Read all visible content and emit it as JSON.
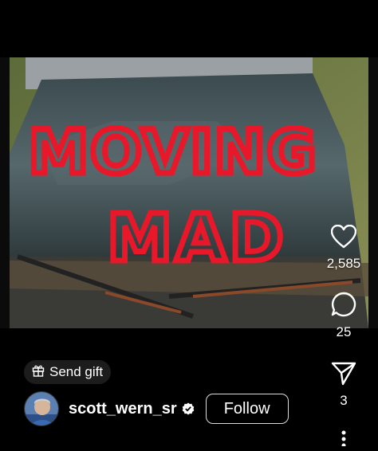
{
  "video": {
    "windshield_text_line1": "MOVING",
    "windshield_text_line2": "MAD"
  },
  "actions": {
    "like_count": "2,585",
    "comment_count": "25",
    "share_count": "3",
    "icons": [
      "heart-icon",
      "comment-icon",
      "send-icon",
      "more-icon"
    ]
  },
  "gift": {
    "label": "Send gift",
    "icon": "gift-icon"
  },
  "author": {
    "username": "scott_wern_sr",
    "follow_label": "Follow",
    "verified": true
  },
  "colors": {
    "background": "#000000",
    "spray_paint": "#e8182a",
    "pill_background": "#1c1c1c"
  }
}
